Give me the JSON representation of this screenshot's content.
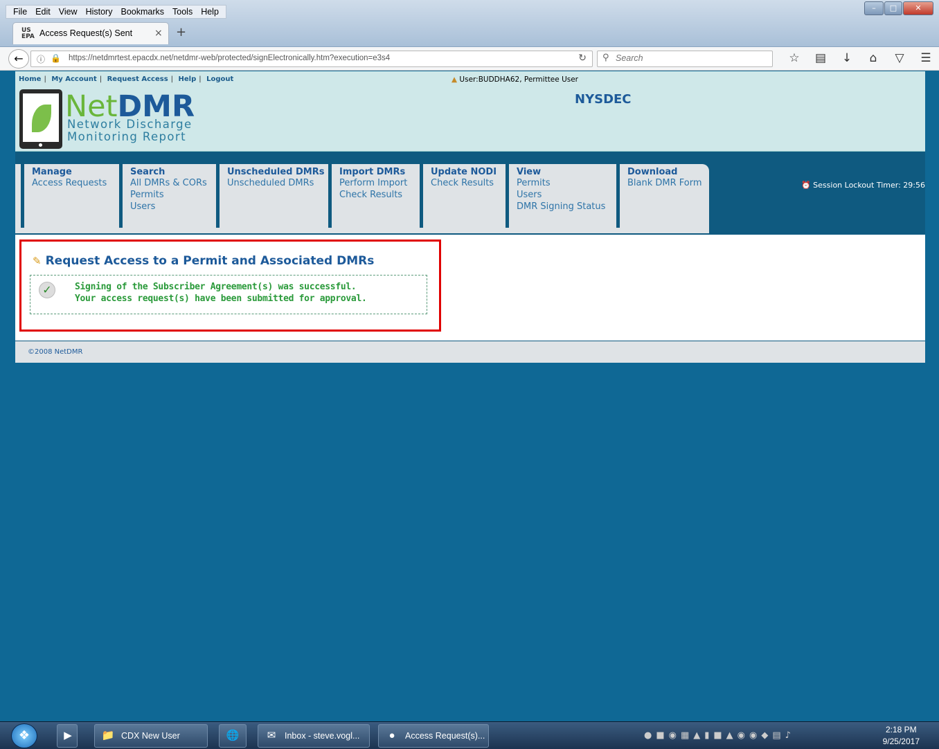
{
  "browser": {
    "menu": [
      "File",
      "Edit",
      "View",
      "History",
      "Bookmarks",
      "Tools",
      "Help"
    ],
    "tab": {
      "favicon_top": "US",
      "favicon_bottom": "EPA",
      "title": "Access Request(s) Sent",
      "close": "×"
    },
    "newtab": "+",
    "url": "https://netdmrtest.epacdx.net/netdmr-web/protected/signElectronically.htm?execution=e3s4",
    "search_placeholder": "Search",
    "window_buttons": {
      "minimize": "–",
      "maximize": "□",
      "close": "✕"
    }
  },
  "site": {
    "top_links": [
      "Home",
      "My Account",
      "Request Access",
      "Help",
      "Logout"
    ],
    "user": "User:BUDDHA62, Permittee User",
    "logo": {
      "net": "Net",
      "dmr": "DMR",
      "line1": "Network Discharge",
      "line2": "Monitoring Report"
    },
    "agency": "NYSDEC",
    "nav": [
      {
        "heading": "Manage",
        "links": [
          "Access Requests"
        ]
      },
      {
        "heading": "Search",
        "links": [
          "All DMRs & CORs",
          "Permits",
          "Users"
        ]
      },
      {
        "heading": "Unscheduled DMRs",
        "links": [
          "Unscheduled DMRs"
        ]
      },
      {
        "heading": "Import DMRs",
        "links": [
          "Perform Import",
          "Check Results"
        ]
      },
      {
        "heading": "Update NODI",
        "links": [
          "Check Results"
        ]
      },
      {
        "heading": "View",
        "links": [
          "Permits",
          "Users",
          "DMR Signing Status"
        ]
      },
      {
        "heading": "Download",
        "links": [
          "Blank DMR Form"
        ]
      }
    ],
    "timer": "Session Lockout Timer: 29:56",
    "page_title": "Request Access to a Permit and Associated DMRs",
    "message_line1": "Signing of the Subscriber Agreement(s) was successful.",
    "message_line2": "Your access request(s) have been submitted for approval.",
    "footer": "©2008 NetDMR"
  },
  "taskbar": {
    "items": [
      "CDX New User",
      "Inbox - steve.vogl...",
      "Access Request(s)..."
    ],
    "time": "2:18 PM",
    "date": "9/25/2017"
  }
}
